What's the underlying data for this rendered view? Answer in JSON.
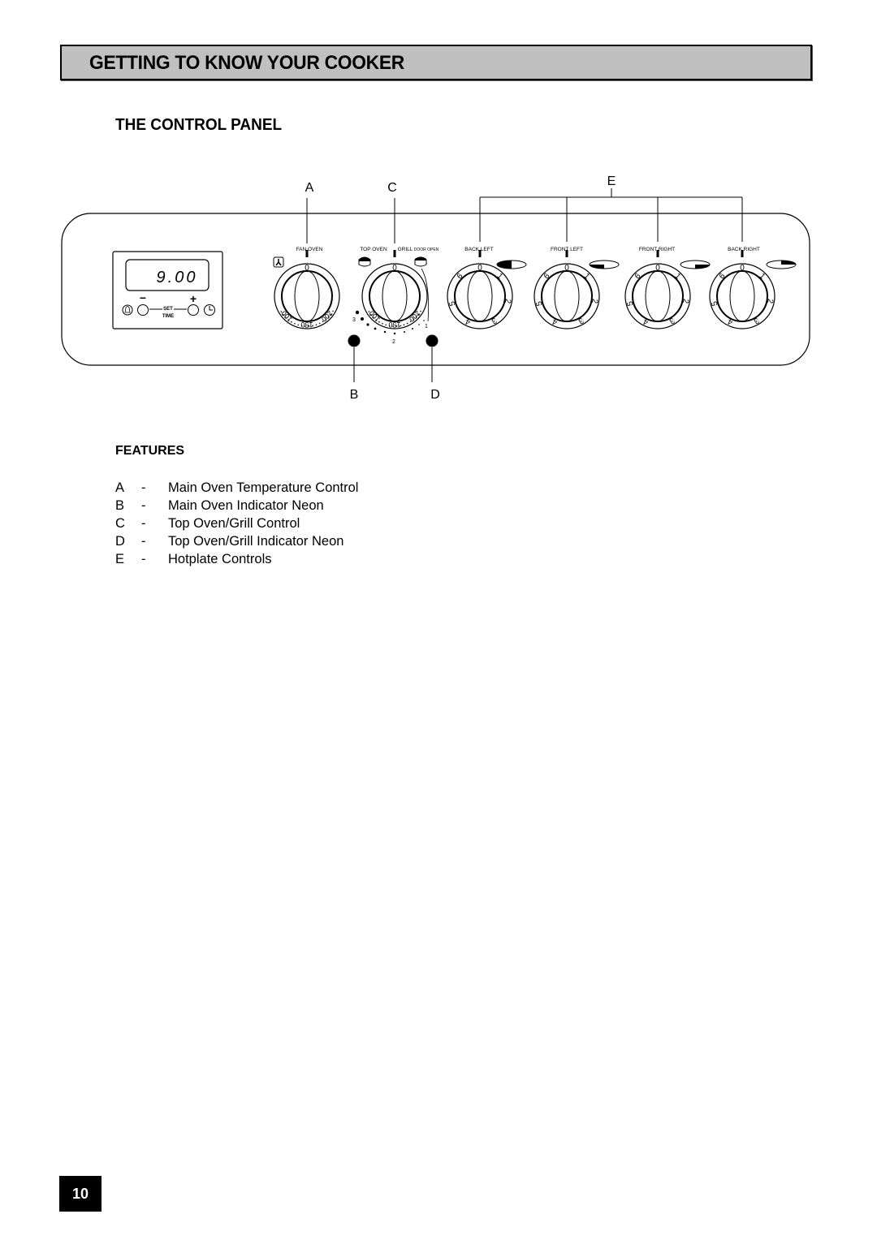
{
  "header": {
    "title": "GETTING TO KNOW YOUR COOKER"
  },
  "section": {
    "title": "THE CONTROL PANEL"
  },
  "diagram": {
    "callouts": {
      "A": "A",
      "B": "B",
      "C": "C",
      "D": "D",
      "E": "E"
    },
    "timer": {
      "display": "9.00",
      "minus": "−",
      "plus": "+",
      "set_label": "SET",
      "time_label": "TIME"
    },
    "knob_labels": {
      "fan_oven": "FAN OVEN",
      "top_oven": "TOP OVEN",
      "grill": "GRILL",
      "door_open": "DOOR OPEN",
      "back_left": "BACK LEFT",
      "front_left": "FRONT LEFT",
      "front_right": "FRONT RIGHT",
      "back_right": "BACK RIGHT"
    },
    "oven_scale": [
      "0",
      "100",
      "150",
      "200"
    ],
    "grill_scale": [
      "1",
      "2",
      "3"
    ],
    "hotplate_scale": [
      "0",
      "1",
      "2",
      "3",
      "4",
      "5",
      "6"
    ]
  },
  "features": {
    "title": "FEATURES",
    "items": [
      {
        "letter": "A",
        "dash": "-",
        "description": "Main Oven Temperature Control"
      },
      {
        "letter": "B",
        "dash": "-",
        "description": "Main Oven Indicator Neon"
      },
      {
        "letter": "C",
        "dash": "-",
        "description": "Top Oven/Grill Control"
      },
      {
        "letter": "D",
        "dash": "-",
        "description": "Top Oven/Grill Indicator Neon"
      },
      {
        "letter": "E",
        "dash": "-",
        "description": "Hotplate Controls"
      }
    ]
  },
  "page": {
    "number": "10"
  }
}
